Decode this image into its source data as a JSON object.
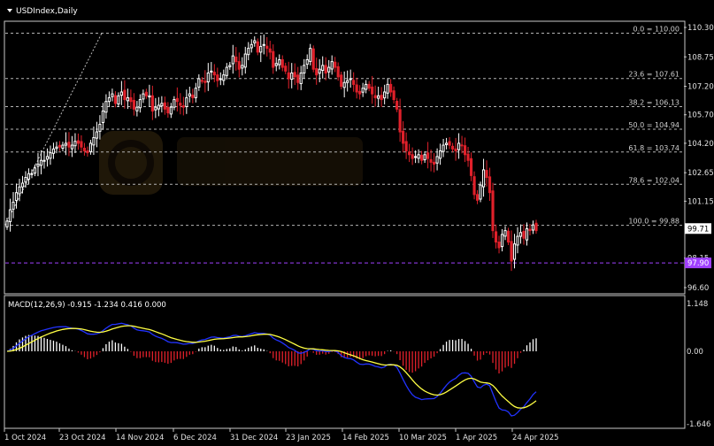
{
  "title": "USDIndex,Daily",
  "icons": {
    "dropdown": "triangle-down-icon"
  },
  "colors": {
    "background": "#000000",
    "bull": "#ffffff",
    "bear": "#e0202a",
    "macd_line": "#2233ff",
    "signal_line": "#ffff44",
    "hist_pos": "#ffffff",
    "hist_neg": "#e0202a",
    "support": "#a040ff",
    "watermark": "#3a2a10"
  },
  "chart_data": [
    {
      "type": "candlestick",
      "title": "USDIndex,Daily",
      "ylim": [
        96.6,
        110.3
      ],
      "price_axis_ticks": [
        "110.30",
        "108.75",
        "107.20",
        "105.70",
        "104.20",
        "102.65",
        "101.15",
        "99.71",
        "98.15",
        "96.60"
      ],
      "current_price": "99.71",
      "support_level": "97.90",
      "fibonacci": [
        {
          "label": "0.0 = 110.00",
          "value": 110.0
        },
        {
          "label": "23.6 = 107.61",
          "value": 107.61
        },
        {
          "label": "38.2 = 106.13",
          "value": 106.13
        },
        {
          "label": "50.0 = 104.94",
          "value": 104.94
        },
        {
          "label": "61.8 = 103.74",
          "value": 103.74
        },
        {
          "label": "78.6 = 102.04",
          "value": 102.04
        },
        {
          "label": "100.0 = 99.88",
          "value": 99.88
        }
      ],
      "x_ticks": [
        "1 Oct 2024",
        "23 Oct 2024",
        "14 Nov 2024",
        "6 Dec 2024",
        "31 Dec 2024",
        "23 Jan 2025",
        "14 Feb 2025",
        "10 Mar 2025",
        "1 Apr 2025",
        "24 Apr 2025"
      ],
      "close_series": [
        100.1,
        100.7,
        101.1,
        101.6,
        101.9,
        102.1,
        102.4,
        102.6,
        102.6,
        102.9,
        103.1,
        103.3,
        103.3,
        103.5,
        103.7,
        103.9,
        104.0,
        104.0,
        104.1,
        104.2,
        104.0,
        104.1,
        104.3,
        104.2,
        104.0,
        103.8,
        103.7,
        104.2,
        104.5,
        104.8,
        105.2,
        105.9,
        106.4,
        106.6,
        106.8,
        106.3,
        106.7,
        106.9,
        106.5,
        106.6,
        106.4,
        106.0,
        106.1,
        106.5,
        106.8,
        106.7,
        106.7,
        105.9,
        106.1,
        106.2,
        106.3,
        106.0,
        105.8,
        106.1,
        106.5,
        106.4,
        106.2,
        106.1,
        106.6,
        106.8,
        106.6,
        107.1,
        107.6,
        107.5,
        107.4,
        107.9,
        108.0,
        107.8,
        107.5,
        107.6,
        107.8,
        108.2,
        108.3,
        108.8,
        108.5,
        108.1,
        108.3,
        108.9,
        109.2,
        109.4,
        109.6,
        109.0,
        109.3,
        109.4,
        109.2,
        109.0,
        108.2,
        108.4,
        108.6,
        108.2,
        108.0,
        107.6,
        107.9,
        107.7,
        107.4,
        107.9,
        108.3,
        108.6,
        109.2,
        108.1,
        107.8,
        108.1,
        108.3,
        107.9,
        108.2,
        108.5,
        108.2,
        107.7,
        107.2,
        107.4,
        107.5,
        107.6,
        107.3,
        106.9,
        106.8,
        107.1,
        107.3,
        107.1,
        106.8,
        106.6,
        106.7,
        106.5,
        106.9,
        107.3,
        106.9,
        106.5,
        106.0,
        104.8,
        104.2,
        103.8,
        103.6,
        103.4,
        103.5,
        103.6,
        103.3,
        103.6,
        103.4,
        103.2,
        103.1,
        103.5,
        103.8,
        104.1,
        104.2,
        104.1,
        103.9,
        103.8,
        104.2,
        104.1,
        103.6,
        103.3,
        102.5,
        101.5,
        101.2,
        102.0,
        102.8,
        102.4,
        101.6,
        99.6,
        99.0,
        98.7,
        99.4,
        99.6,
        99.0,
        98.0,
        98.9,
        99.3,
        99.5,
        99.2,
        99.7,
        99.6,
        99.9,
        99.6
      ],
      "macd": {
        "label": "MACD(12,26,9) -0.915 -1.234 0.416 0.000",
        "ticks": [
          "1.148",
          "0.00",
          "-1.646"
        ]
      }
    }
  ]
}
